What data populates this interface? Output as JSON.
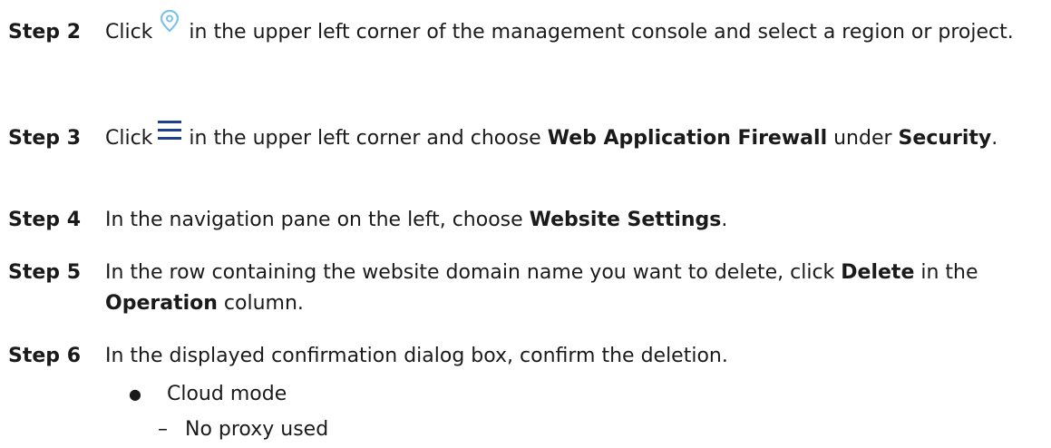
{
  "steps": [
    {
      "label": "Step 2",
      "pre": "Click",
      "icon": "location-pin-icon",
      "post": "in the upper left corner of the management console and select a region or project."
    },
    {
      "label": "Step 3",
      "pre": "Click",
      "icon": "menu-icon",
      "post": "in the upper left corner and choose",
      "bold1": "Web Application Firewall",
      "mid": "under",
      "bold2": "Security",
      "end": "."
    },
    {
      "label": "Step 4",
      "text": "In the navigation pane on the left, choose",
      "bold1": "Website Settings",
      "end": "."
    },
    {
      "label": "Step 5",
      "text": "In the row containing the website domain name you want to delete, click",
      "bold1": "Delete",
      "mid": "in the",
      "bold2": "Operation",
      "end": "column."
    },
    {
      "label": "Step 6",
      "text": "In the displayed confirmation dialog box, confirm the deletion."
    }
  ],
  "bullets": [
    {
      "marker": "●",
      "text": "Cloud mode"
    },
    {
      "marker": "–",
      "text": "No proxy used"
    }
  ],
  "colors": {
    "text": "#1a1a1a",
    "location_icon": "#7ec3ea",
    "menu_icon": "#1f3f8f"
  }
}
